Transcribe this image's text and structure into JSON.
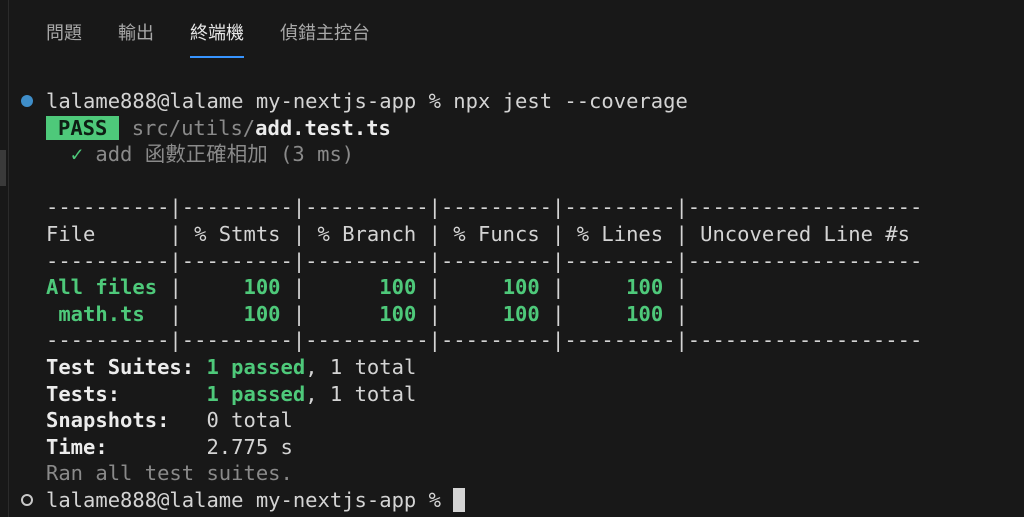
{
  "tabs": [
    {
      "label": "問題",
      "active": false
    },
    {
      "label": "輸出",
      "active": false
    },
    {
      "label": "終端機",
      "active": true
    },
    {
      "label": "偵錯主控台",
      "active": false
    }
  ],
  "terminal": {
    "prompt": "lalame888@lalame my-nextjs-app % ",
    "command": "npx jest --coverage",
    "pass_badge": "PASS",
    "test_file_dir": "src/utils/",
    "test_file_name": "add.test.ts",
    "test_check": "✓",
    "test_name": "add 函數正確相加",
    "test_time": "(3 ms)",
    "table": {
      "sep_line": "----------|---------|----------|---------|---------|-------------------",
      "header_line": "File      | % Stmts | % Branch | % Funcs | % Lines | Uncovered Line #s",
      "rows": [
        {
          "file": "All files",
          "stmts": "100",
          "branch": "100",
          "funcs": "100",
          "lines": "100",
          "uncovered": ""
        },
        {
          "file": " math.ts",
          "stmts": "100",
          "branch": "100",
          "funcs": "100",
          "lines": "100",
          "uncovered": ""
        }
      ]
    },
    "summary": {
      "suites_label": "Test Suites:",
      "suites_passed": "1 passed",
      "suites_total": ", 1 total",
      "tests_label": "Tests:",
      "tests_passed": "1 passed",
      "tests_total": ", 1 total",
      "snapshots_label": "Snapshots:",
      "snapshots_value": "0 total",
      "time_label": "Time:",
      "time_value": "2.775 s",
      "ran_all": "Ran all test suites."
    },
    "final_prompt": "lalame888@lalame my-nextjs-app % "
  },
  "colors": {
    "background": "#181818",
    "pass_green": "#4ec97a",
    "tab_active_underline": "#3794ff",
    "prompt_dot": "#3f8ec9"
  }
}
